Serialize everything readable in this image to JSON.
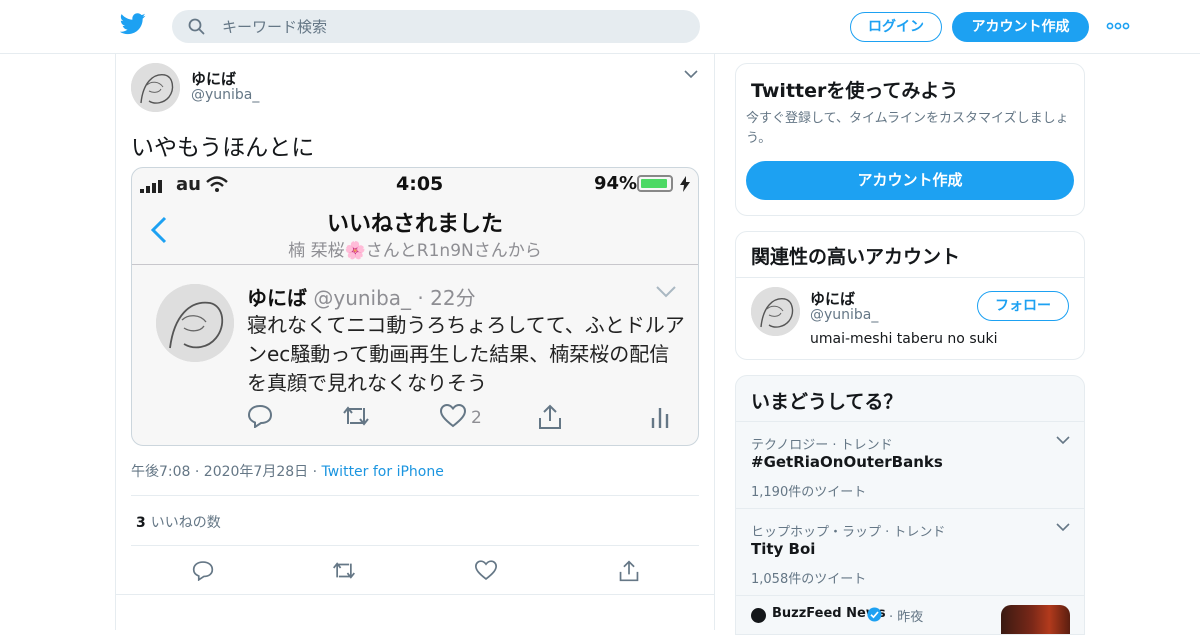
{
  "header": {
    "search_placeholder": "キーワード検索",
    "login_label": "ログイン",
    "signup_label": "アカウント作成"
  },
  "tweet": {
    "author_name": "ゆにば",
    "author_handle": "@yuniba_",
    "text": "いやもうほんとに",
    "timestamp": "午後7:08 · 2020年7月28日 · ",
    "source": "Twitter for iPhone",
    "like_count": "3",
    "like_label": "いいねの数",
    "screenshot": {
      "carrier": "au",
      "time": "4:05",
      "battery": "94%",
      "battery_level": 0.94,
      "title": "いいねされました",
      "subtitle": "楠 栞桜🌸さんとR1n9Nさんから",
      "inner_name": "ゆにば",
      "inner_handle": "@yuniba_ · 22分",
      "inner_text": "寝れなくてニコ動うろちょろしてて、ふとドルアンec騒動って動画再生した結果、楠栞桜の配信を真顔で見れなくなりそう",
      "inner_like_count": "2"
    }
  },
  "sidebar": {
    "promo": {
      "title": "Twitterを使ってみよう",
      "description": "今すぐ登録して、タイムラインをカスタマイズしましょう。",
      "button_label": "アカウント作成"
    },
    "related": {
      "title": "関連性の高いアカウント",
      "name": "ゆにば",
      "handle": "@yuniba_",
      "bio": "umai-meshi taberu no suki",
      "follow_label": "フォロー"
    },
    "trends": {
      "title": "いまどうしてる？",
      "items": [
        {
          "category": "テクノロジー · トレンド",
          "name": "#GetRiaOnOuterBanks",
          "count": "1,190件のツイート"
        },
        {
          "category": "ヒップホップ・ラップ · トレンド",
          "name": "Tity Boi",
          "count": "1,058件のツイート"
        }
      ],
      "news": {
        "source": "BuzzFeed News",
        "time": "· 昨夜"
      }
    }
  },
  "colors": {
    "brand": "#1da1f2",
    "link": "#1b95e0",
    "muted": "#657786"
  }
}
